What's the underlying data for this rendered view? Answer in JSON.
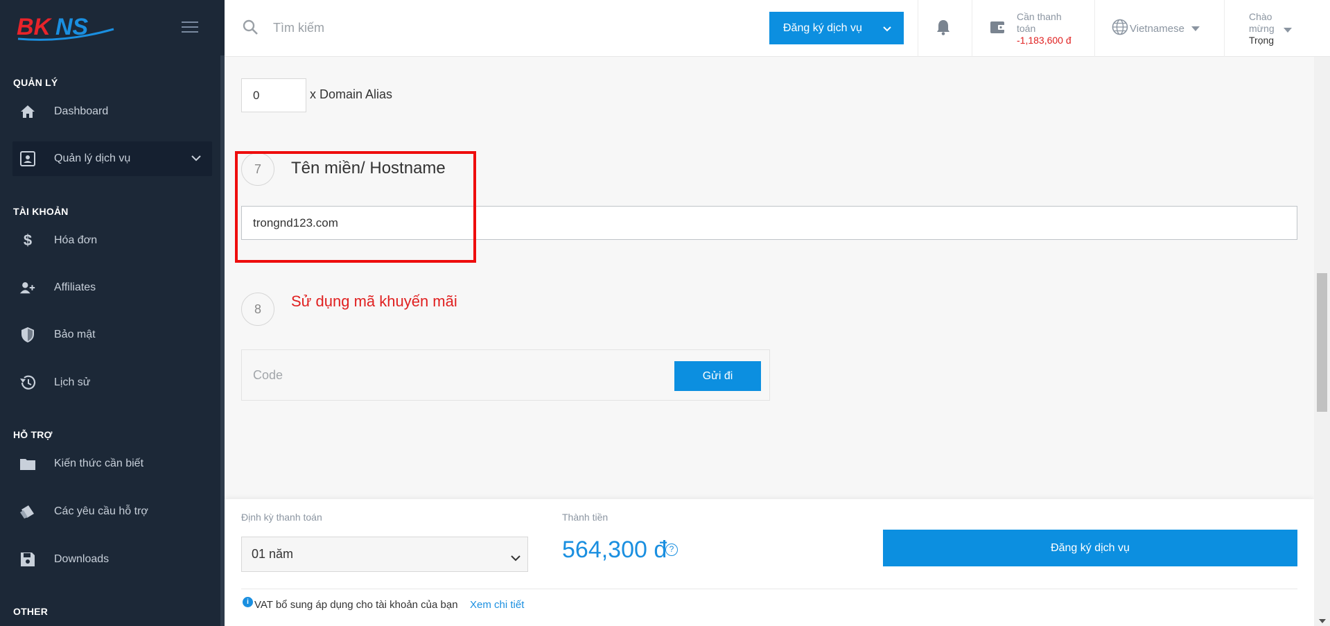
{
  "brand": {
    "logo_text": "BKNS"
  },
  "sidebar": {
    "sections": [
      {
        "title": "QUẢN LÝ"
      },
      {
        "title": "TÀI KHOẢN"
      },
      {
        "title": "HỖ TRỢ"
      },
      {
        "title": "OTHER"
      }
    ],
    "items": [
      {
        "label": "Dashboard",
        "icon": "home-icon"
      },
      {
        "label": "Quản lý dịch vụ",
        "icon": "contact-card-icon"
      },
      {
        "label": "Hóa đơn",
        "icon": "dollar-icon"
      },
      {
        "label": "Affiliates",
        "icon": "add-user-icon"
      },
      {
        "label": "Bảo mật",
        "icon": "shield-icon"
      },
      {
        "label": "Lịch sử",
        "icon": "history-icon"
      },
      {
        "label": "Kiến thức cần biết",
        "icon": "folder-icon"
      },
      {
        "label": "Các yêu cầu hỗ trợ",
        "icon": "tickets-icon"
      },
      {
        "label": "Downloads",
        "icon": "save-icon"
      }
    ]
  },
  "topbar": {
    "search_placeholder": "Tìm kiếm",
    "register_label": "Đăng ký dịch vụ",
    "balance_label": "Cần thanh toán",
    "balance_value": "-1,183,600 đ",
    "language": "Vietnamese",
    "greeting": "Chào mừng",
    "user_name": "Trọng"
  },
  "form": {
    "alias_count": "0",
    "alias_label": "x Domain Alias",
    "step7_number": "7",
    "step7_title": "Tên miền/ Hostname",
    "hostname_value": "trongnd123.com",
    "step8_number": "8",
    "step8_title": "Sử dụng mã khuyến mãi",
    "code_placeholder": "Code",
    "send_label": "Gửi đi"
  },
  "order_bar": {
    "cycle_label": "Định kỳ thanh toán",
    "cycle_value": "01 năm",
    "total_label": "Thành tiền",
    "total_value": "564,300 đ",
    "register_label": "Đăng ký dịch vụ",
    "vat_text": "VAT bổ sung áp dụng cho tài khoản của bạn",
    "vat_link": "Xem chi tiết"
  },
  "colors": {
    "primary": "#0c8fe0",
    "sidebar_bg": "#1c2837",
    "alert_red": "#e02020",
    "highlight_red": "#ee0d0d"
  }
}
